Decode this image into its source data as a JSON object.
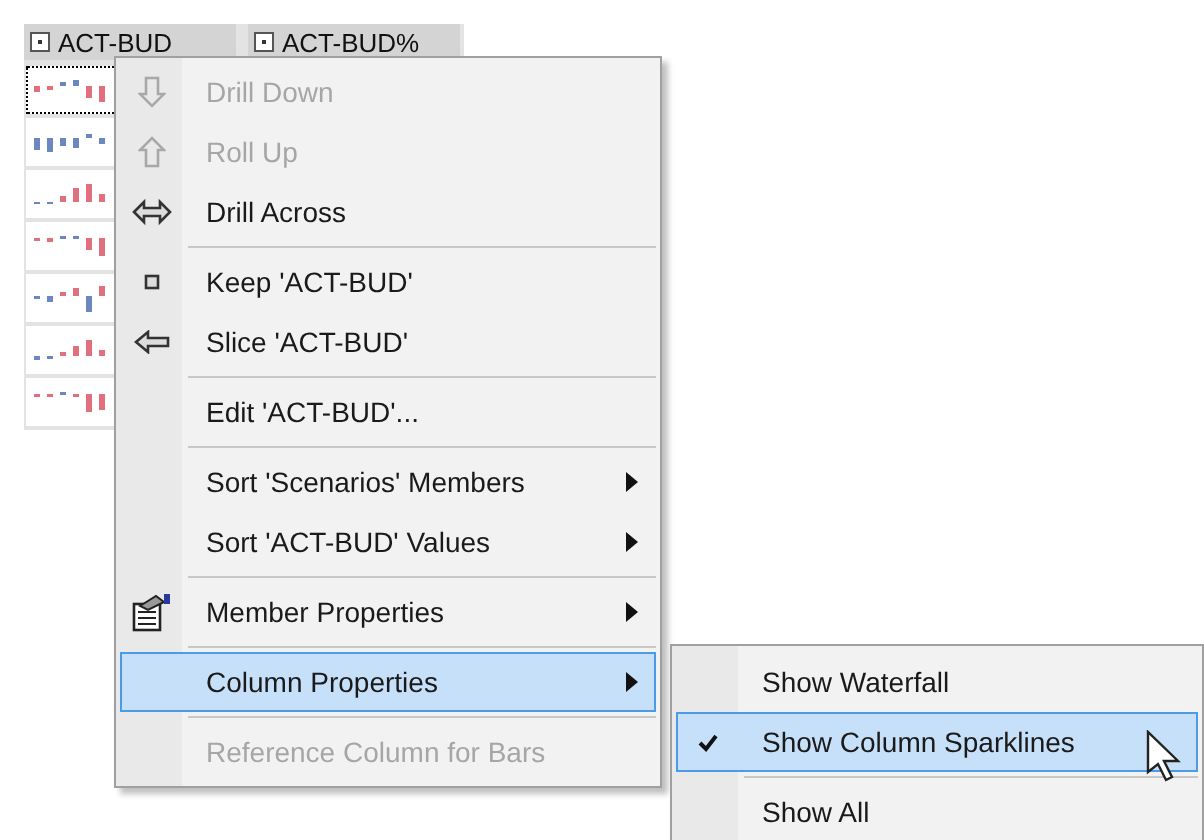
{
  "grid": {
    "headers": [
      {
        "label": "ACT-BUD",
        "kind": "expand"
      },
      {
        "label": "ACT-BUD%",
        "kind": "expand"
      }
    ],
    "rows": [
      {
        "focused": true
      },
      {
        "focused": false
      },
      {
        "focused": false
      },
      {
        "focused": false
      },
      {
        "focused": false
      },
      {
        "focused": false
      },
      {
        "focused": false
      }
    ]
  },
  "context_menu": {
    "items": [
      {
        "kind": "item",
        "label": "Drill Down",
        "disabled": true,
        "selected": false,
        "submenu": false
      },
      {
        "kind": "item",
        "label": "Roll Up",
        "disabled": true,
        "selected": false,
        "submenu": false
      },
      {
        "kind": "item",
        "label": "Drill Across",
        "disabled": false,
        "selected": false,
        "submenu": false
      },
      {
        "kind": "separator"
      },
      {
        "kind": "item",
        "label": "Keep 'ACT-BUD'",
        "disabled": false,
        "selected": false,
        "submenu": false
      },
      {
        "kind": "item",
        "label": "Slice 'ACT-BUD'",
        "disabled": false,
        "selected": false,
        "submenu": false
      },
      {
        "kind": "separator"
      },
      {
        "kind": "item",
        "label": "Edit 'ACT-BUD'...",
        "disabled": false,
        "selected": false,
        "submenu": false
      },
      {
        "kind": "separator"
      },
      {
        "kind": "item",
        "label": "Sort 'Scenarios' Members",
        "disabled": false,
        "selected": false,
        "submenu": true
      },
      {
        "kind": "item",
        "label": "Sort 'ACT-BUD' Values",
        "disabled": false,
        "selected": false,
        "submenu": true
      },
      {
        "kind": "separator"
      },
      {
        "kind": "item",
        "label": "Member Properties",
        "disabled": false,
        "selected": false,
        "submenu": true
      },
      {
        "kind": "separator"
      },
      {
        "kind": "item",
        "label": "Column Properties",
        "disabled": false,
        "selected": true,
        "submenu": true
      },
      {
        "kind": "separator"
      },
      {
        "kind": "item",
        "label": "Reference Column for Bars",
        "disabled": true,
        "selected": false,
        "submenu": false
      }
    ]
  },
  "submenu": {
    "items": [
      {
        "kind": "item",
        "label": "Show Waterfall",
        "checked": false,
        "selected": false
      },
      {
        "kind": "item",
        "label": "Show Column Sparklines",
        "checked": true,
        "selected": true
      },
      {
        "kind": "separator"
      },
      {
        "kind": "item",
        "label": "Show All",
        "checked": false,
        "selected": false
      }
    ]
  }
}
